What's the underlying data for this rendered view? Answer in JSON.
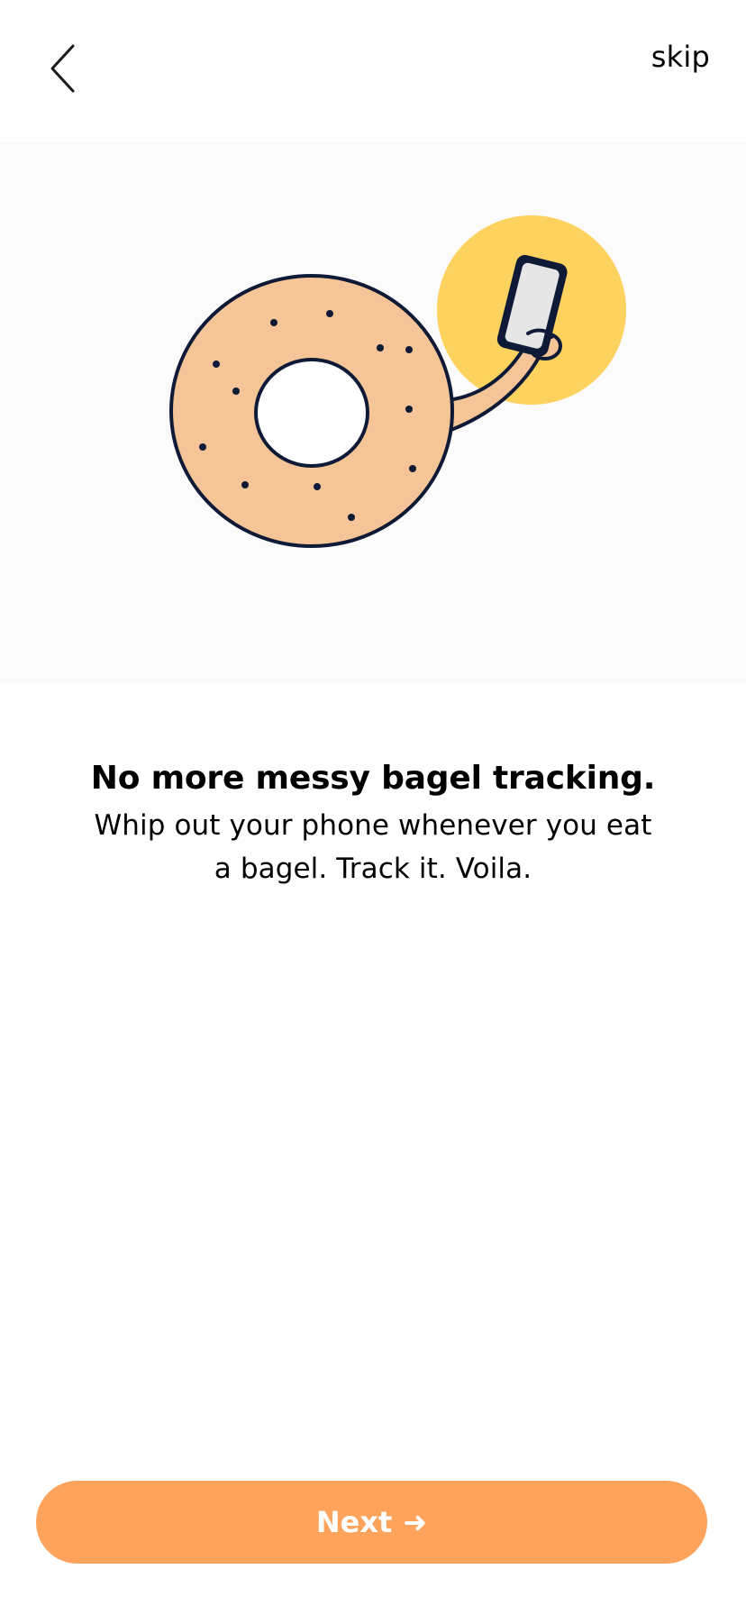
{
  "header": {
    "back_icon": "chevron-left-icon",
    "skip_label": "skip"
  },
  "illustration": {
    "description_icon": "bagel-holding-phone-illustration",
    "colors": {
      "bagel": "#f5c598",
      "sun": "#fdd25e",
      "phone_screen": "#e6e6e6",
      "outline": "#0e1a36",
      "background": "#fbfbfb"
    }
  },
  "content": {
    "headline": "No more messy bagel tracking.",
    "subtitle_line1": "Whip out your phone whenever you eat",
    "subtitle_line2": "a bagel. Track it. Voila."
  },
  "footer": {
    "next_label": "Next",
    "next_arrow": "➜",
    "accent_color": "#fda35c"
  }
}
